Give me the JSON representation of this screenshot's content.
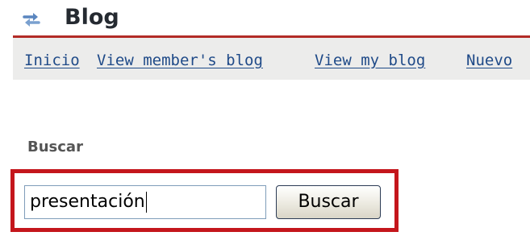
{
  "header": {
    "title": "Blog",
    "icon": "refresh-arrows-icon"
  },
  "nav": {
    "items": [
      {
        "label": "Inicio"
      },
      {
        "label": "View member's blog"
      },
      {
        "label": "View my blog"
      },
      {
        "label": "Nuevo"
      }
    ]
  },
  "search": {
    "section_label": "Buscar",
    "input_value": "presentación",
    "button_label": "Buscar"
  },
  "colors": {
    "header_rule": "#b22b26",
    "nav_background": "#ececeb",
    "link": "#1f4a88",
    "highlight_border": "#c4161c",
    "icon_blue": "#5a86bf"
  }
}
